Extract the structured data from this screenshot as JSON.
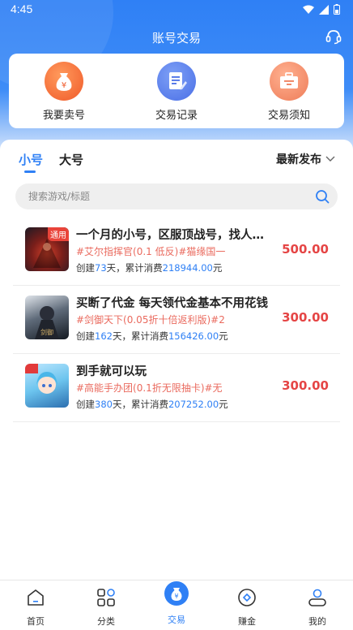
{
  "status_bar": {
    "time": "4:45"
  },
  "header": {
    "title": "账号交易",
    "service_icon": "headset-icon"
  },
  "actions": [
    {
      "label": "我要卖号",
      "icon": "money-bag-icon",
      "color": "#f26b3a"
    },
    {
      "label": "交易记录",
      "icon": "document-edit-icon",
      "color": "#4f7bea"
    },
    {
      "label": "交易须知",
      "icon": "briefcase-icon",
      "color": "#f08a6a"
    }
  ],
  "tabs": [
    {
      "label": "小号",
      "active": true
    },
    {
      "label": "大号",
      "active": false
    }
  ],
  "sort": {
    "label": "最新发布"
  },
  "search": {
    "placeholder": "搜索游戏/标题"
  },
  "items": [
    {
      "title": "一个月的小号，区服顶战号，找人…",
      "tags": "#艾尔指挥官(0.1 低反)#猫缘国一",
      "badge": "通用",
      "stats_prefix": "创建",
      "days": "73",
      "stats_mid": "天，累计消费",
      "spent": "218944.00",
      "stats_suffix": "元",
      "price": "500.00"
    },
    {
      "title": "买断了代金 每天领代金基本不用花钱",
      "tags": "#剑御天下(0.05折十倍返利版)#2",
      "badge": "",
      "stats_prefix": "创建",
      "days": "162",
      "stats_mid": "天，累计消费",
      "spent": "156426.00",
      "stats_suffix": "元",
      "price": "300.00"
    },
    {
      "title": "到手就可以玩",
      "tags": "#高能手办团(0.1折无限抽卡)#无",
      "badge": "",
      "stats_prefix": "创建",
      "days": "380",
      "stats_mid": "天，累计消费",
      "spent": "207252.00",
      "stats_suffix": "元",
      "price": "300.00"
    }
  ],
  "nav": [
    {
      "label": "首页",
      "icon": "home-icon",
      "active": false
    },
    {
      "label": "分类",
      "icon": "grid-icon",
      "active": false
    },
    {
      "label": "交易",
      "icon": "trade-bag-icon",
      "active": true
    },
    {
      "label": "赚金",
      "icon": "coin-icon",
      "active": false
    },
    {
      "label": "我的",
      "icon": "user-icon",
      "active": false
    }
  ],
  "colors": {
    "primary": "#2f80f5",
    "price": "#e54545",
    "tag": "#ea6a5e"
  }
}
